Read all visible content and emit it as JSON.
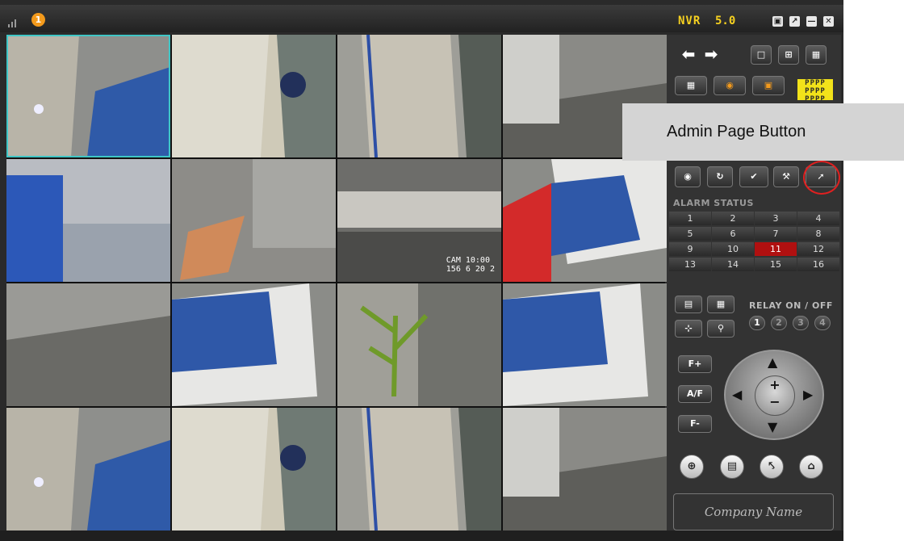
{
  "app": {
    "notification_count": "1",
    "brand": "NVR",
    "version": "5.0",
    "window_buttons": [
      "lock-icon",
      "restore-icon",
      "minimize-icon",
      "close-icon"
    ]
  },
  "cameras": [
    {
      "scene": "office-corridor-chairs"
    },
    {
      "scene": "ceiling-dome-camera"
    },
    {
      "scene": "glass-door-corridor"
    },
    {
      "scene": "carpet-office-corner"
    },
    {
      "scene": "blue-partition-desk"
    },
    {
      "scene": "desk-workstation"
    },
    {
      "scene": "reception-wall",
      "osd_line1": "CAM 10:00",
      "osd_line2": "156 6 20 2"
    },
    {
      "scene": "floor-map-board"
    },
    {
      "scene": "carpet-office-corner"
    },
    {
      "scene": "floor-map-board"
    },
    {
      "scene": "plant-office"
    },
    {
      "scene": "floor-map-board"
    },
    {
      "scene": "office-corridor-chairs"
    },
    {
      "scene": "ceiling-dome-camera"
    },
    {
      "scene": "glass-door-corridor"
    },
    {
      "scene": "carpet-office-corner"
    }
  ],
  "panel": {
    "alarm_status_label": "ALARM STATUS",
    "alarms": [
      "1",
      "2",
      "3",
      "4",
      "5",
      "6",
      "7",
      "8",
      "9",
      "10",
      "11",
      "12",
      "13",
      "14",
      "15",
      "16"
    ],
    "active_alarm": "11",
    "relay_label": "RELAY ON / OFF",
    "relays": [
      "1",
      "2",
      "3",
      "4"
    ],
    "focus_buttons": [
      "F+",
      "A/F",
      "F-"
    ],
    "ptz_center_plus": "+",
    "ptz_center_minus": "−",
    "company_name": "Company Name",
    "p_grid": "PPPP"
  },
  "annotation": {
    "label": "Admin Page Button",
    "ring_color": "#e02020"
  },
  "colors": {
    "accent": "#f5d020",
    "selection": "#3fc6c6",
    "alarm_active": "#b01010"
  }
}
